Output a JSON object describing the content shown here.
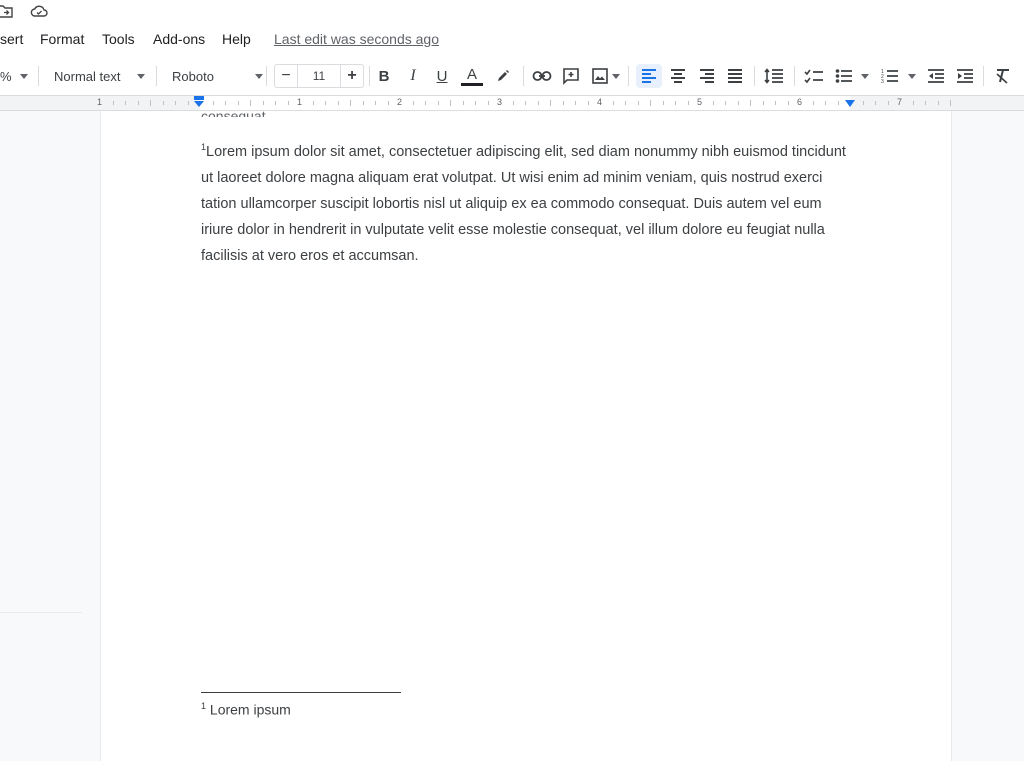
{
  "menu": {
    "items": [
      "sert",
      "Format",
      "Tools",
      "Add-ons",
      "Help"
    ],
    "last_edit": "Last edit was seconds ago"
  },
  "toolbar": {
    "zoom_fragment": "%",
    "style": "Normal text",
    "font": "Roboto",
    "font_size": "11",
    "minus": "−",
    "plus": "+",
    "bold": "B",
    "italic": "I",
    "underline": "U",
    "text_color": "A"
  },
  "ruler": {
    "numbers": [
      "1",
      "1",
      "2",
      "3",
      "4",
      "5",
      "6",
      "7"
    ]
  },
  "document": {
    "cut_line": "consequat.",
    "superscript": "1",
    "paragraph": "Lorem ipsum dolor sit amet, consectetuer adipiscing elit, sed diam nonummy nibh euismod tincidunt ut laoreet dolore magna aliquam erat volutpat. Ut wisi enim ad minim veniam, quis nostrud exerci tation ullamcorper suscipit lobortis nisl ut aliquip ex ea commodo consequat. Duis autem vel eum iriure dolor in hendrerit in vulputate velit esse molestie consequat, vel illum dolore eu feugiat nulla facilisis at vero eros et accumsan.",
    "footnote_number": "1",
    "footnote_text": "Lorem ipsum"
  },
  "colors": {
    "accent": "#1a73e8",
    "active_bg": "#e8f0fe",
    "text": "#3c4043"
  }
}
